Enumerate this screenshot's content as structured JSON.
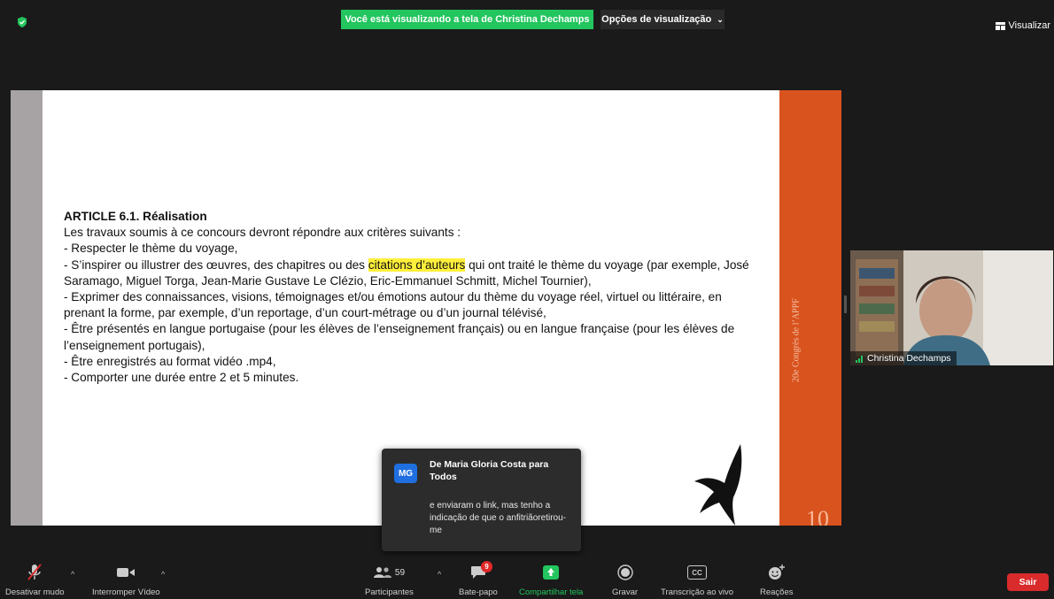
{
  "top": {
    "sharing_banner": "Você está visualizando a tela de Christina Dechamps",
    "view_options": "Opções de visualização",
    "view_label": "Visualizar"
  },
  "slide": {
    "heading": "ARTICLE 6.1. Réalisation",
    "intro": "Les travaux soumis à ce concours devront répondre aux critères suivants :",
    "item1": "- Respecter le thème du voyage,",
    "item2_pre": "- S’inspirer ou illustrer des œuvres, des chapitres ou des ",
    "item2_highlight": "citations d’auteurs",
    "item2_post": " qui ont traité le thème du voyage (par exemple, José Saramago, Miguel Torga, Jean-Marie Gustave Le Clézio, Eric-Emmanuel Schmitt, Michel Tournier),",
    "item3": "- Exprimer des connaissances, visions, témoignages et/ou émotions autour du thème du voyage réel, virtuel ou littéraire, en prenant la forme, par exemple, d’un reportage, d’un court-métrage ou d’un journal télévisé,",
    "item4": "- Être présentés en langue portugaise (pour les élèves de l’enseignement français) ou en langue française (pour les élèves de l’enseignement portugais),",
    "item5": "- Être enregistrés au format vidéo .mp4,",
    "item6": "- Comporter une durée entre 2 et 5 minutes.",
    "side_text": "20e Congrès de l’APPF",
    "page_number": "10",
    "left_color": "#a7a3a4",
    "right_color": "#d9531e"
  },
  "participant": {
    "name": "Christina Dechamps"
  },
  "chat_toast": {
    "avatar_initials": "MG",
    "from": "De Maria Gloria Costa para Todos",
    "message": "e enviaram o link, mas tenho a indicação de que o anfitriãoretirou-me"
  },
  "toolbar": {
    "mute": "Desativar mudo",
    "video": "Interromper Vídeo",
    "participants": "Participantes",
    "participants_count": "59",
    "chat": "Bate-papo",
    "chat_badge": "9",
    "share": "Compartilhar tela",
    "record": "Gravar",
    "transcript": "Transcrição ao vivo",
    "cc": "CC",
    "reactions": "Reações",
    "leave": "Sair"
  },
  "colors": {
    "share_green": "#22c55e",
    "leave_red": "#d92b2b",
    "avatar_blue": "#1f6fe0"
  }
}
